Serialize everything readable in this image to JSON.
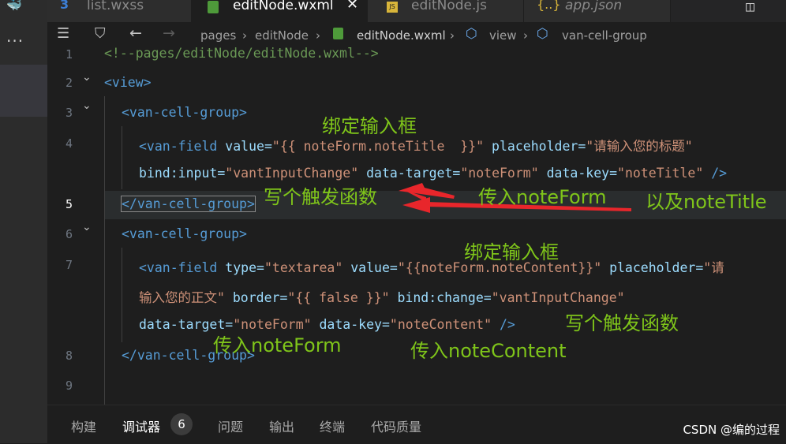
{
  "tabs": [
    {
      "label": "list.wxss",
      "icon": "css3-icon",
      "active": false
    },
    {
      "label": "editNode.wxml",
      "icon": "wxml-file-icon",
      "active": true
    },
    {
      "label": "editNode.js",
      "icon": "js-file-icon",
      "active": false
    },
    {
      "label": "app.json",
      "icon": "json-braces-icon",
      "active": false
    }
  ],
  "breadcrumb": [
    "pages",
    "editNode",
    "editNode.wxml",
    "view",
    "van-cell-group"
  ],
  "line_numbers": [
    "1",
    "2",
    "3",
    "4",
    "",
    "5",
    "6",
    "7",
    "",
    "",
    "8",
    "9"
  ],
  "code": {
    "l1": {
      "comment": "<!--pages/editNode/editNode.wxml-->"
    },
    "l2": {
      "open": "<view>"
    },
    "l3": {
      "open": "<van-cell-group>"
    },
    "l4": {
      "tag": "<van-field",
      "a1": "value=",
      "v1": "\"{{ noteForm.noteTitle  }}\"",
      "a2": "placeholder=",
      "v2": "\"请输入您的标题\""
    },
    "l4b": {
      "a1": "bind:input=",
      "v1": "\"vantInputChange\"",
      "a2": "data-target=",
      "v2": "\"noteForm\"",
      "a3": "data-key=",
      "v3": "\"noteTitle\"",
      "close": "/>"
    },
    "l5": {
      "close": "</van-cell-group>"
    },
    "l6": {
      "open": "<van-cell-group>"
    },
    "l7": {
      "tag": "<van-field",
      "a1": "type=",
      "v1": "\"textarea\"",
      "a2": "value=",
      "v2": "\"{{noteForm.noteContent}}\"",
      "a3": "placeholder=",
      "v3": "\"请"
    },
    "l7b": {
      "v1": "输入您的正文\"",
      "a1": "border=",
      "v2": "\"{{ false }}\"",
      "a2": "bind:change=",
      "v3": "\"vantInputChange\""
    },
    "l7c": {
      "a1": "data-target=",
      "v1": "\"noteForm\"",
      "a2": "data-key=",
      "v2": "\"noteContent\"",
      "close": "/>"
    },
    "l8": {
      "close": "</van-cell-group>"
    }
  },
  "annotations": {
    "bind_input_1": "绑定输入框",
    "write_trigger_1": "写个触发函数",
    "pass_noteform_1": "传入noteForm",
    "and_notetitle": "以及noteTitle",
    "bind_input_2": "绑定输入框",
    "write_trigger_2": "写个触发函数",
    "pass_noteform_2": "传入noteForm",
    "pass_notecontent": "传入noteContent"
  },
  "panel": {
    "tabs": [
      "构建",
      "调试器",
      "问题",
      "输出",
      "终端",
      "代码质量"
    ],
    "active": "调试器",
    "badge": "6"
  },
  "watermark": "CSDN @编的过程",
  "colors": {
    "annotation": "#7fc51a",
    "arrow": "#e8262b",
    "tag": "#569cd6",
    "attr": "#9cdcfe",
    "string": "#ce9178"
  }
}
